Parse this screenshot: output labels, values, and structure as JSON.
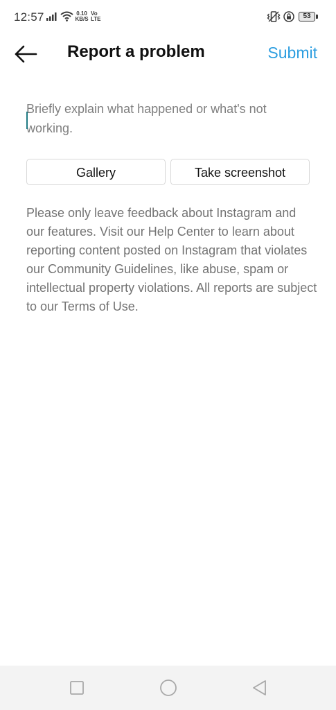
{
  "status_bar": {
    "time": "12:57",
    "net_speed_value": "0.10",
    "net_speed_unit": "KB/S",
    "volte_top": "Vo",
    "volte_bottom": "LTE",
    "battery_level": "53",
    "icons": [
      "signal-icon",
      "wifi-icon",
      "vibrate-icon",
      "lock-icon",
      "battery-icon"
    ]
  },
  "header": {
    "back_icon": "arrow-left-icon",
    "title": "Report a problem",
    "submit_label": "Submit"
  },
  "form": {
    "description_value": "",
    "description_placeholder": "Briefly explain what happened or what's not working.",
    "gallery_label": "Gallery",
    "screenshot_label": "Take screenshot"
  },
  "info_text": "Please only leave feedback about Instagram and our features. Visit our Help Center to learn about reporting content posted on Instagram that violates our Community Guidelines, like abuse, spam or intellectual property violations. All reports are subject to our Terms of Use.",
  "nav_bar": {
    "icons": [
      "recents-square-icon",
      "home-circle-icon",
      "back-triangle-icon"
    ]
  },
  "colors": {
    "accent": "#2d9ee0",
    "title_text": "#111111",
    "body_text": "#737373",
    "button_border": "#d8d8d8",
    "cursor": "#1f7a83",
    "nav_background": "#f3f3f3"
  }
}
